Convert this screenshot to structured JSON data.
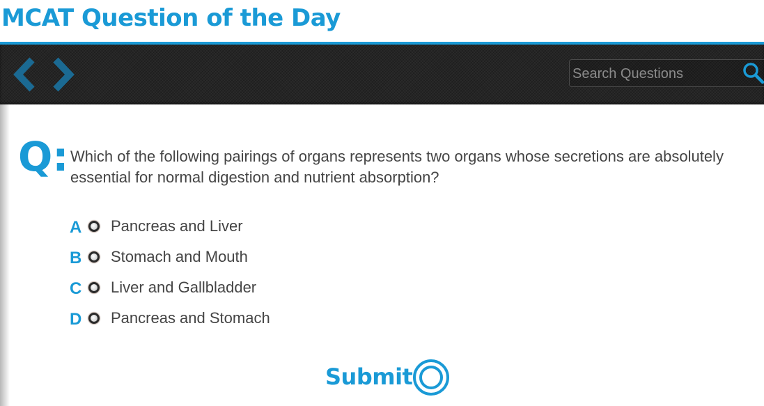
{
  "header": {
    "title": "MCAT Question of the Day"
  },
  "toolbar": {
    "prev_icon": "chevron-left-icon",
    "next_icon": "chevron-right-icon",
    "search": {
      "placeholder": "Search Questions",
      "value": "",
      "icon": "search-icon"
    }
  },
  "question": {
    "marker": "Q:",
    "text": "Which of the following pairings of organs represents two organs whose secretions are absolutely essential for normal digestion and nutrient absorption?",
    "answers": [
      {
        "letter": "A",
        "label": "Pancreas and Liver",
        "selected": false
      },
      {
        "letter": "B",
        "label": "Stomach and Mouth",
        "selected": false
      },
      {
        "letter": "C",
        "label": "Liver and Gallbladder",
        "selected": false
      },
      {
        "letter": "D",
        "label": "Pancreas and Stomach",
        "selected": false
      }
    ]
  },
  "submit": {
    "label": "Submit",
    "icon": "target-ring-icon"
  },
  "colors": {
    "accent": "#1a9ad6",
    "toolbar_bg": "#252525",
    "nav_arrow": "#1b6a93",
    "text": "#444444"
  }
}
